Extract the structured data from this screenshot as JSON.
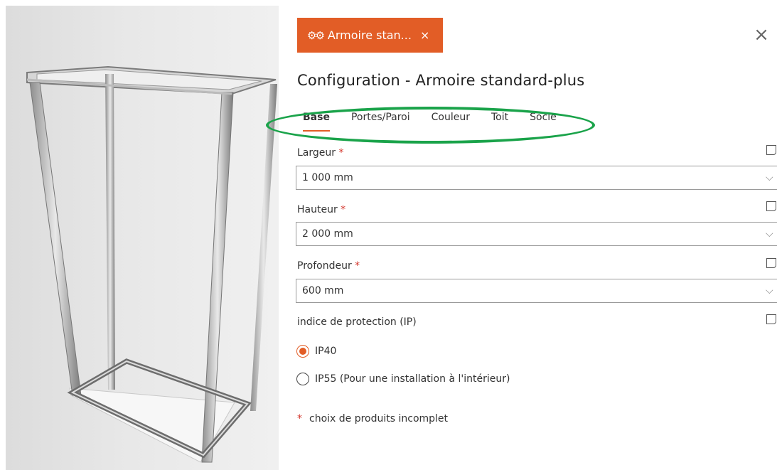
{
  "viewer": {
    "description_icon": "3d-cabinet-frame"
  },
  "chip": {
    "label": "Armoire stan...",
    "icon": "gears-icon",
    "close": "×"
  },
  "panel": {
    "close": "×",
    "title": "Configuration - Armoire standard-plus",
    "tabs": [
      {
        "label": "Base",
        "active": true
      },
      {
        "label": "Portes/Paroi"
      },
      {
        "label": "Couleur"
      },
      {
        "label": "Toit"
      },
      {
        "label": "Socle"
      }
    ]
  },
  "fields": {
    "largeur": {
      "label": "Largeur",
      "required": "*",
      "value": "1 000 mm"
    },
    "hauteur": {
      "label": "Hauteur",
      "required": "*",
      "value": "2 000 mm"
    },
    "profondeur": {
      "label": "Profondeur",
      "required": "*",
      "value": "600 mm"
    },
    "ip": {
      "label": "indice de protection (IP)",
      "options": [
        {
          "label": "IP40",
          "checked": true
        },
        {
          "label": "IP55 (Pour une installation à l'intérieur)",
          "checked": false
        }
      ]
    }
  },
  "footnote": {
    "star": "*",
    "text": "choix de produits incomplet"
  },
  "colors": {
    "accent": "#e25d26",
    "highlight": "#1aa34a",
    "required": "#d4362c"
  }
}
